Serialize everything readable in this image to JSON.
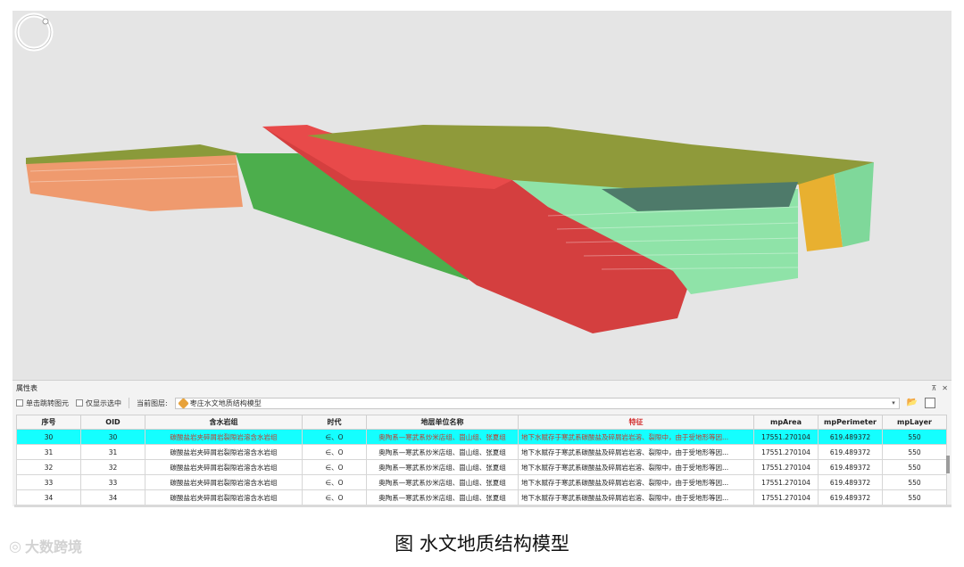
{
  "panel": {
    "title": "属性表",
    "pin_icon": "pin-icon",
    "close_icon": "close-icon"
  },
  "toolbar": {
    "jump_label": "单击跳转图元",
    "selected_only_label": "仅显示选中",
    "current_layer_label": "当前图层:",
    "current_layer_value": "枣庄水文地质结构模型"
  },
  "table": {
    "columns": [
      "序号",
      "OID",
      "含水岩组",
      "时代",
      "地层单位名称",
      "特征",
      "mpArea",
      "mpPerimeter",
      "mpLayer"
    ],
    "rows": [
      [
        "30",
        "30",
        "碳酸盐岩夹碎屑岩裂隙岩溶含水岩组",
        "∈、O",
        "奥陶系—寒武系炒米店组、崮山组、张夏组",
        "地下水赋存于寒武系碳酸盐及碎屑岩岩溶、裂隙中，由于受地形等因...",
        "17551.270104",
        "619.489372",
        "550"
      ],
      [
        "31",
        "31",
        "碳酸盐岩夹碎屑岩裂隙岩溶含水岩组",
        "∈、O",
        "奥陶系—寒武系炒米店组、崮山组、张夏组",
        "地下水赋存于寒武系碳酸盐及碎屑岩岩溶、裂隙中，由于受地形等因...",
        "17551.270104",
        "619.489372",
        "550"
      ],
      [
        "32",
        "32",
        "碳酸盐岩夹碎屑岩裂隙岩溶含水岩组",
        "∈、O",
        "奥陶系—寒武系炒米店组、崮山组、张夏组",
        "地下水赋存于寒武系碳酸盐及碎屑岩岩溶、裂隙中，由于受地形等因...",
        "17551.270104",
        "619.489372",
        "550"
      ],
      [
        "33",
        "33",
        "碳酸盐岩夹碎屑岩裂隙岩溶含水岩组",
        "∈、O",
        "奥陶系—寒武系炒米店组、崮山组、张夏组",
        "地下水赋存于寒武系碳酸盐及碎屑岩岩溶、裂隙中，由于受地形等因...",
        "17551.270104",
        "619.489372",
        "550"
      ],
      [
        "34",
        "34",
        "碳酸盐岩夹碎屑岩裂隙岩溶含水岩组",
        "∈、O",
        "奥陶系—寒武系炒米店组、崮山组、张夏组",
        "地下水赋存于寒武系碳酸盐及碎屑岩岩溶、裂隙中，由于受地形等因...",
        "17551.270104",
        "619.489372",
        "550"
      ]
    ],
    "selected_row_index": 0,
    "selected_color": "#14ffff"
  },
  "caption": "图  水文地质结构模型",
  "watermark": "大数跨境",
  "colors": {
    "viewport_bg": "#e5e5e5",
    "red_layer": "#d63a3a",
    "green_layer": "#5cb85c",
    "light_green_layer": "#8fe3a8",
    "orange_layer": "#f0a070",
    "yellow_layer": "#e8b030"
  }
}
